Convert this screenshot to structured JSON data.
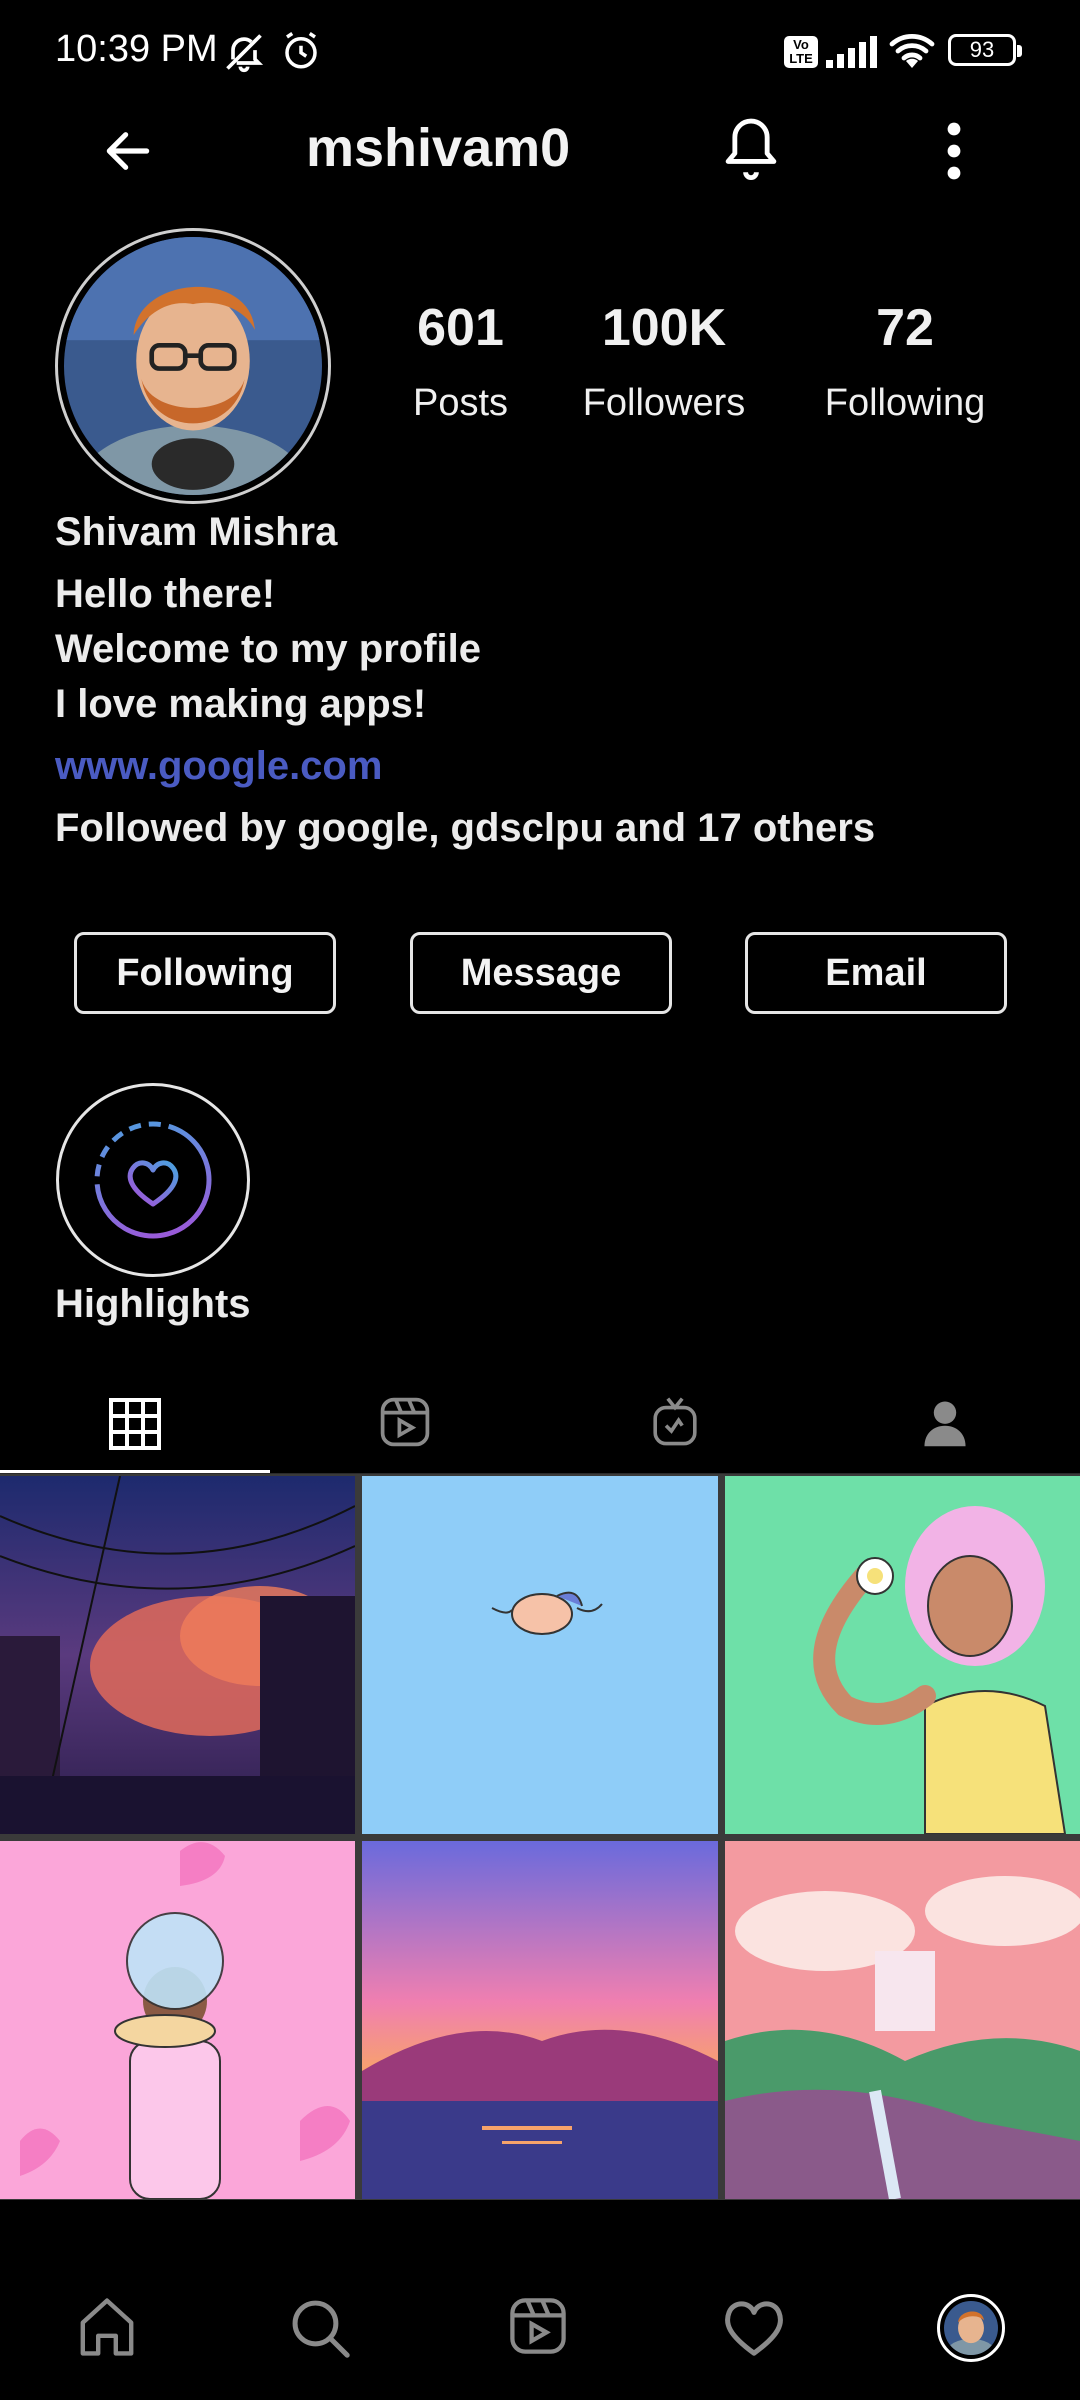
{
  "status_bar": {
    "time": "10:39 PM",
    "battery": "93",
    "icons": [
      "muted-bell-icon",
      "alarm-icon",
      "volte-icon",
      "signal-icon",
      "wifi-icon",
      "battery-icon"
    ]
  },
  "app_bar": {
    "username": "mshivam0",
    "icons": [
      "back-arrow-icon",
      "bell-icon",
      "more-vertical-icon"
    ]
  },
  "profile": {
    "stats": [
      {
        "value": "601",
        "label": "Posts"
      },
      {
        "value": "100K",
        "label": "Followers"
      },
      {
        "value": "72",
        "label": "Following"
      }
    ],
    "name": "Shivam Mishra",
    "bio_lines": [
      "Hello there!",
      "Welcome to my profile",
      "I love making apps!"
    ],
    "link": "www.google.com",
    "followed_by": "Followed by google, gdsclpu and 17 others"
  },
  "buttons": {
    "following": "Following",
    "message": "Message",
    "email": "Email"
  },
  "highlights": {
    "label": "Highlights",
    "icon": "heart-icon"
  },
  "tabs": [
    "grid-icon",
    "reels-icon",
    "igtv-icon",
    "tagged-icon"
  ],
  "bottom_nav": [
    "home-icon",
    "search-icon",
    "reels-icon",
    "heart-icon",
    "profile-avatar"
  ],
  "colors": {
    "background": "#000000",
    "link": "#4a5bc2",
    "text": "#ececec"
  }
}
